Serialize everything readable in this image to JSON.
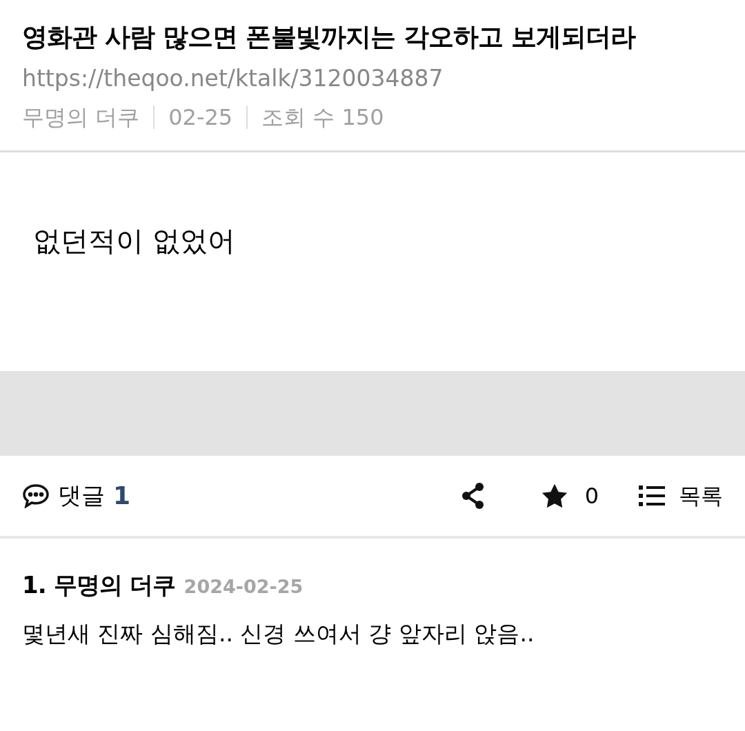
{
  "post": {
    "title": "영화관 사람 많으면 폰불빛까지는 각오하고 보게되더라",
    "url": "https://theqoo.net/ktalk/3120034887",
    "meta": [
      "무명의 더쿠",
      "02-25",
      "조회 수 150"
    ],
    "body": "없던적이 없었어"
  },
  "actions": {
    "comments_label": "댓글",
    "comments_count": "1",
    "star_count": "0",
    "list_label": "목록"
  },
  "comments": [
    {
      "author": "1. 무명의 더쿠",
      "date": "2024-02-25",
      "text": "몇년새 진짜 심해짐.. 신경 쓰여서 걍 앞자리 앉음.."
    }
  ]
}
